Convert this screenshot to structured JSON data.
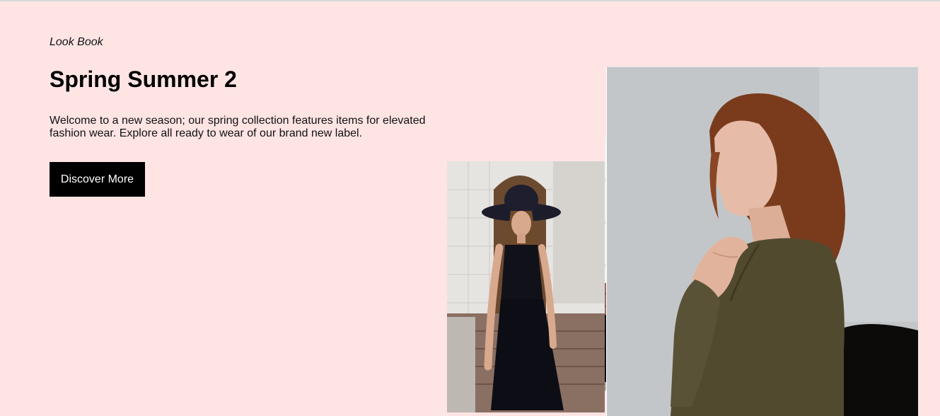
{
  "hero": {
    "eyebrow": "Look Book",
    "headline": "Spring Summer 2",
    "intro": "Welcome to a new season; our spring collection features items for elevated fashion wear. Explore all ready to wear of our brand new label.",
    "cta_label": "Discover More"
  },
  "gallery": {
    "images": [
      {
        "subject": "woman in black hat and black dress"
      },
      {
        "subject": "stone archway and steps"
      },
      {
        "subject": "red-haired woman in olive sweater"
      }
    ]
  },
  "colors": {
    "page_background": "#ffe4e4",
    "button_background": "#000000",
    "button_text": "#ffffff"
  }
}
